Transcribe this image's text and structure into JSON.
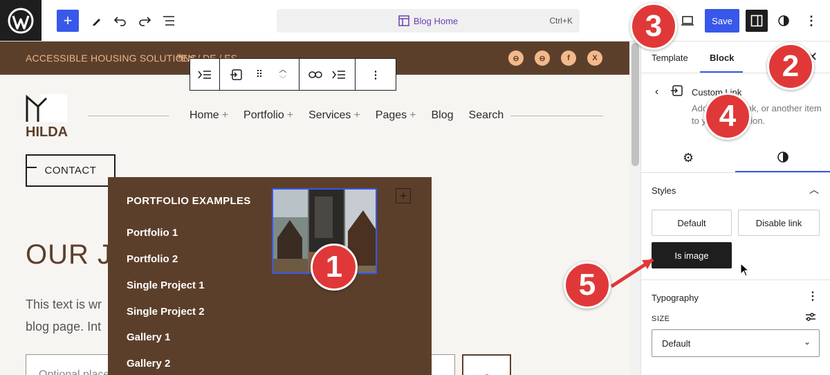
{
  "topbar": {
    "command_title": "Blog Home",
    "command_shortcut": "Ctrl+K",
    "save_label": "Save"
  },
  "site": {
    "tagline": "ACCESSIBLE HOUSING SOLUTIONS",
    "languages": "EN / DE / ES",
    "logo_text": "HILDA",
    "nav": [
      {
        "label": "Home",
        "plus": "+"
      },
      {
        "label": "Portfolio",
        "plus": "+"
      },
      {
        "label": "Services",
        "plus": "+"
      },
      {
        "label": "Pages",
        "plus": "+"
      },
      {
        "label": "Blog",
        "plus": ""
      },
      {
        "label": "Search",
        "plus": ""
      }
    ],
    "contact_label": "CONTACT",
    "hero_partial": "OUR JO",
    "body_partial_1": "This text is wr",
    "body_partial_2": "blog page. Int",
    "search_placeholder": "Optional placeholder..."
  },
  "dropdown": {
    "title": "PORTFOLIO EXAMPLES",
    "items": [
      "Portfolio 1",
      "Portfolio 2",
      "Single Project 1",
      "Single Project 2",
      "Gallery 1",
      "Gallery 2"
    ]
  },
  "sidebar": {
    "tabs": [
      "Template",
      "Block"
    ],
    "block_name": "Custom Link",
    "block_desc": "Add a page, link, or another item to your navigation.",
    "styles_heading": "Styles",
    "style_options": [
      "Default",
      "Disable link",
      "Is image"
    ],
    "typography_heading": "Typography",
    "size_label": "SIZE",
    "size_value": "Default"
  },
  "badges": [
    "1",
    "2",
    "3",
    "4",
    "5"
  ],
  "colors": {
    "wp_blue": "#3858e9",
    "site_brown": "#5c3f2b",
    "tagline_orange": "#e8b48a",
    "badge_red": "#e03838"
  }
}
